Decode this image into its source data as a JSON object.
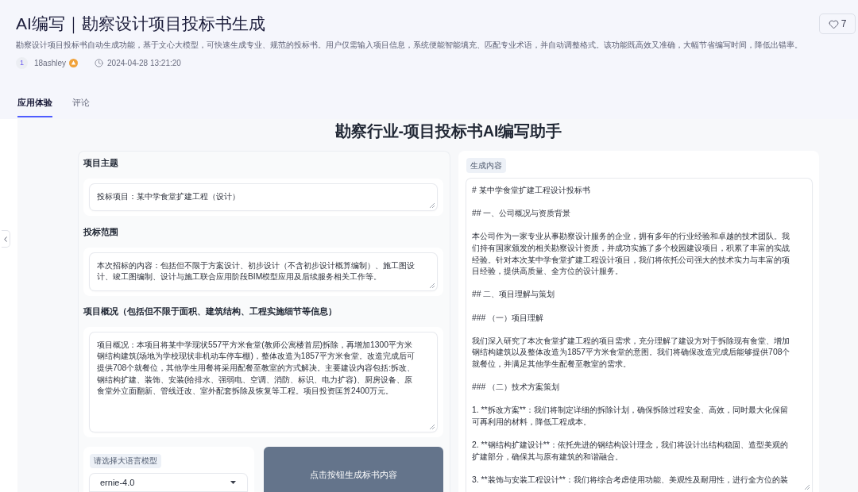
{
  "header": {
    "title": "AI编写｜勘察设计项目投标书生成",
    "description": "勘察设计项目投标书自动生成功能，基于文心大模型，可快速生成专业、规范的投标书。用户仅需输入项目信息，系统便能智能填充、匹配专业术语，并自动调整格式。该功能既高效又准确，大幅节省编写时间，降低出错率。",
    "author": {
      "avatar": "1",
      "name": "18ashley"
    },
    "timestamp": "2024-04-28 13:21:20",
    "likes": "7"
  },
  "tabs": [
    {
      "label": "应用体验",
      "selected": true
    },
    {
      "label": "评论",
      "selected": false
    }
  ],
  "app": {
    "title": "勘察行业-项目投标书AI编写助手",
    "fields": [
      {
        "label": "项目主题",
        "value": "投标项目：某中学食堂扩建工程（设计）"
      },
      {
        "label": "投标范围",
        "value": "本次招标的内容：包括但不限于方案设计、初步设计（不含初步设计概算编制）、施工图设计、竣工图编制、设计与施工联合应用阶段BIM模型应用及后续服务相关工作等。"
      },
      {
        "label": "项目概况（包括但不限于面积、建筑结构、工程实施细节等信息）",
        "value": "项目概况：本项目将某中学现状557平方米食堂(教师公寓楼首层)拆除，再增加1300平方米钢结构建筑(场地为学校现状非机动车停车棚)，整体改造为1857平方米食堂。改造完成后可提供708个就餐位，其他学生用餐将采用配餐至教室的方式解决。主要建设内容包括:拆改、钢结构扩建、装饰、安装(给排水、强弱电、空调、消防、标识、电力扩容)、厨房设备、原食堂外立面翻新、管线迁改、室外配套拆除及恢复等工程。项目投资匡算2400万元。"
      }
    ],
    "model_select": {
      "label": "请选择大语言模型",
      "value": "ernie-4.0"
    },
    "generate_button": "点击按钮生成标书内容",
    "output": {
      "label": "生成内容",
      "paragraphs": [
        "# 某中学食堂扩建工程设计投标书",
        "## 一、公司概况与资质背景",
        "本公司作为一家专业从事勘察设计服务的企业，拥有多年的行业经验和卓越的技术团队。我们持有国家颁发的相关勘察设计资质，并成功实施了多个校园建设项目，积累了丰富的实战经验。针对本次某中学食堂扩建工程设计项目，我们将依托公司强大的技术实力与丰富的项目经验，提供高质量、全方位的设计服务。",
        "## 二、项目理解与策划",
        "### （一）项目理解",
        "我们深入研究了本次食堂扩建工程的项目需求，充分理解了建设方对于拆除现有食堂、增加钢结构建筑以及整体改造为1857平方米食堂的意图。我们将确保改造完成后能够提供708个就餐位，并满足其他学生配餐至教室的需求。",
        "### （二）技术方案策划",
        "1. **拆改方案**：我们将制定详细的拆除计划，确保拆除过程安全、高效，同时最大化保留可再利用的材料，降低工程成本。",
        "2. **钢结构扩建设计**：依托先进的钢结构设计理念，我们将设计出结构稳固、造型美观的扩建部分，确保其与原有建筑的和谐融合。",
        "3. **装饰与安装工程设计**：我们将综合考虑使用功能、美观性及耐用性，进行全方位的装"
      ]
    }
  }
}
